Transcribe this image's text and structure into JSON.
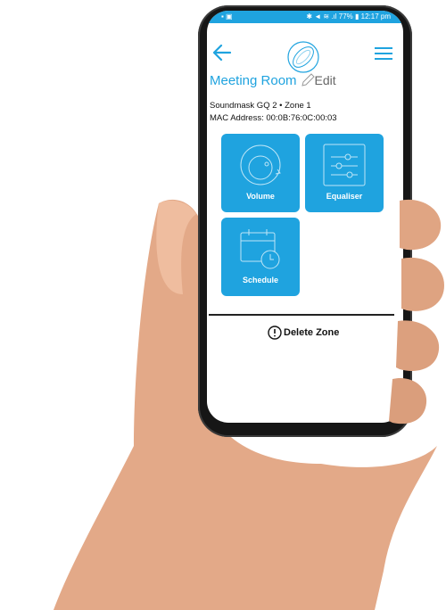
{
  "statusbar": {
    "left": "▪ ▣",
    "right": "✱ ◄ ≋ .ıl 77% ▮ 12:17 pm"
  },
  "header": {
    "title": "Meeting Room",
    "edit_label": "Edit"
  },
  "device": {
    "line1": "Soundmask GQ 2 •  Zone 1",
    "line2": "MAC Address: 00:0B:76:0C:00:03"
  },
  "tiles": [
    {
      "label": "Volume",
      "icon": "volume-knob-icon"
    },
    {
      "label": "Equaliser",
      "icon": "equaliser-sliders-icon"
    },
    {
      "label": "Schedule",
      "icon": "calendar-clock-icon"
    }
  ],
  "actions": {
    "delete_label": "Delete Zone"
  },
  "colors": {
    "accent": "#1fa3df",
    "skin": "#e7b090",
    "phone_body": "#161616"
  }
}
